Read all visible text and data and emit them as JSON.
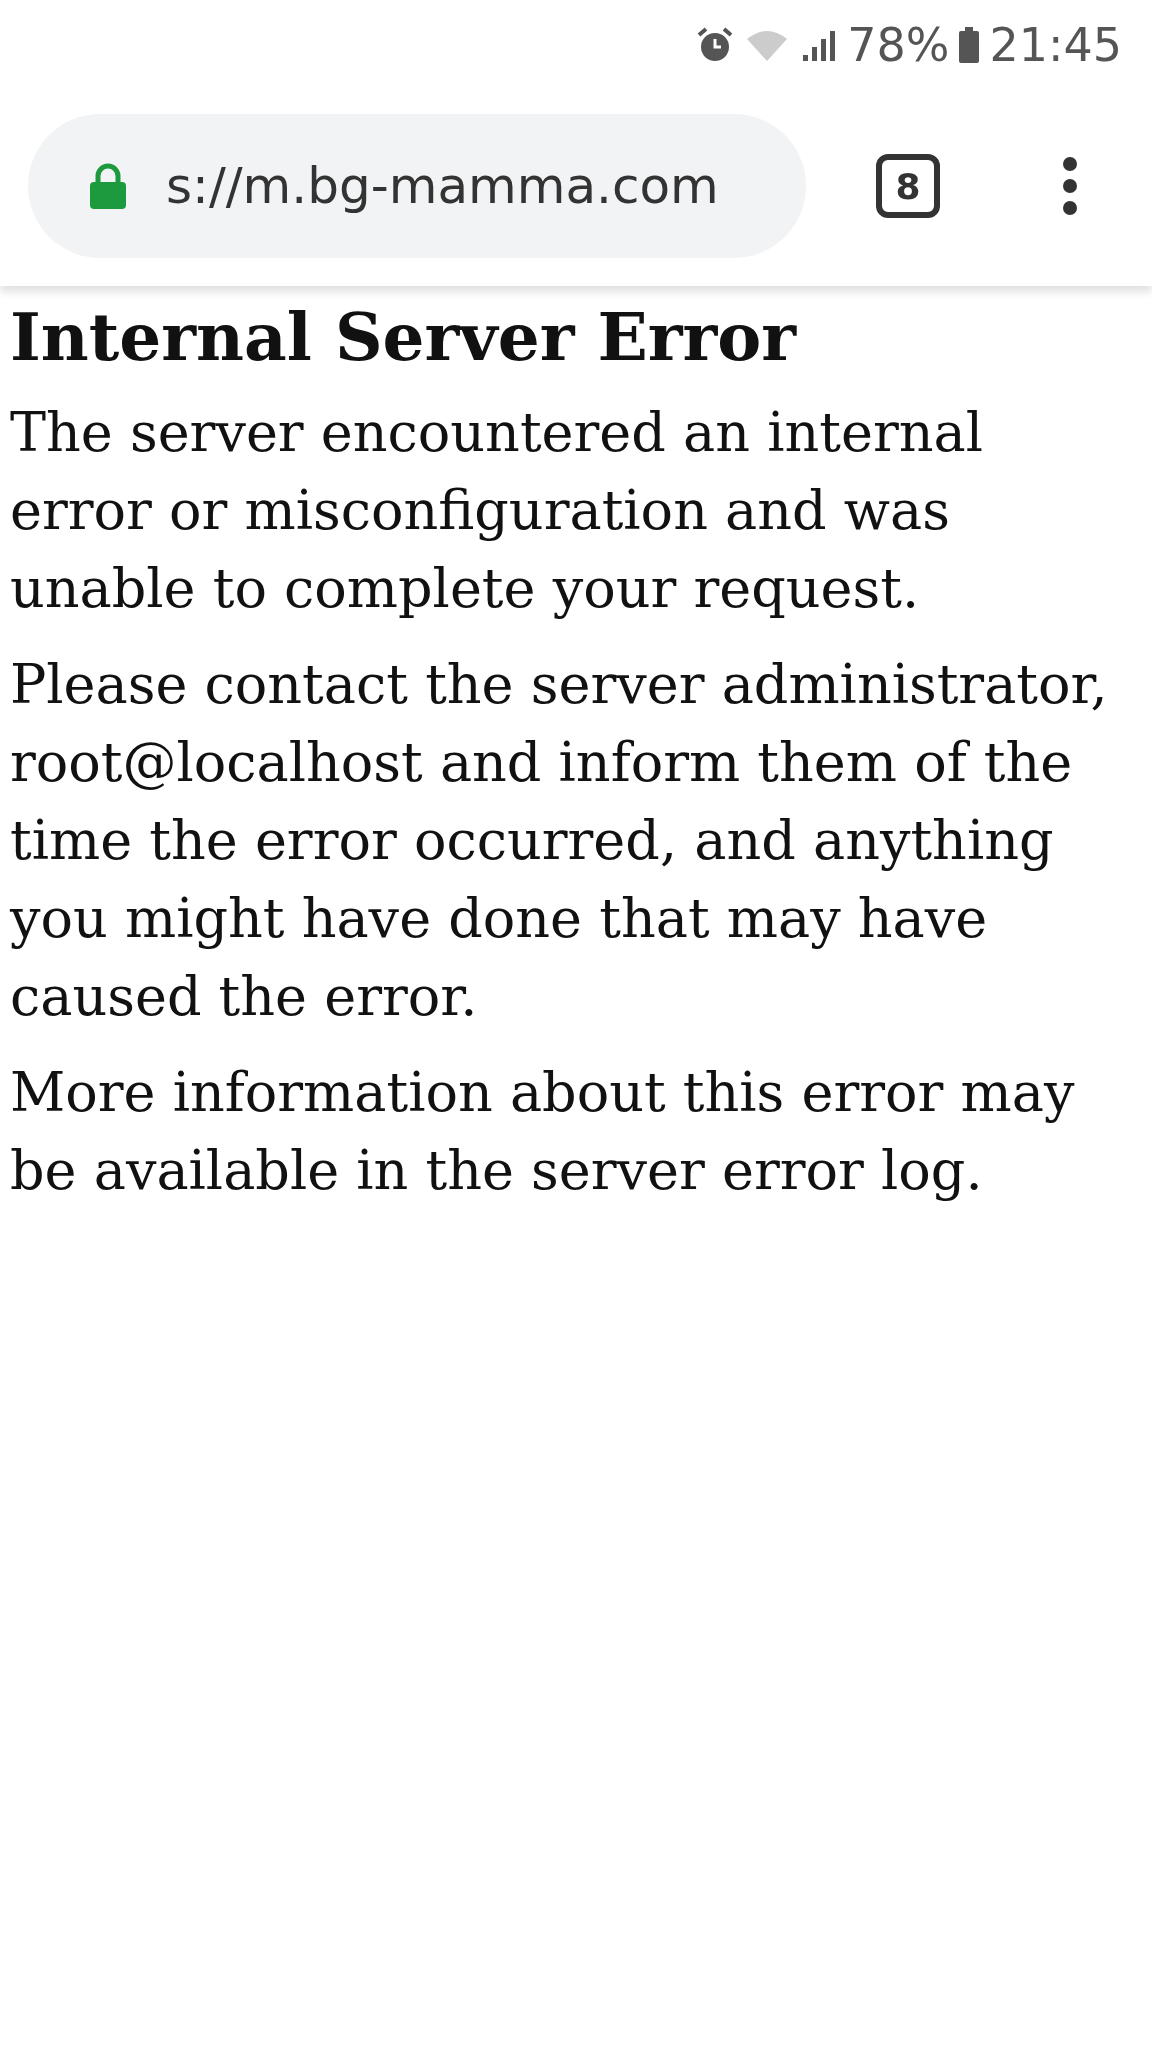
{
  "status_bar": {
    "battery": "78%",
    "time": "21:45"
  },
  "browser_bar": {
    "url": "s://m.bg-mamma.com",
    "tab_count": "8"
  },
  "page": {
    "heading": "Internal Server Error",
    "paragraphs": [
      "The server encountered an internal error or misconfiguration and was unable to complete your request.",
      "Please contact the server administrator, root@localhost and inform them of the time the error occurred, and anything you might have done that may have caused the error.",
      "More information about this error may be available in the server error log."
    ]
  }
}
